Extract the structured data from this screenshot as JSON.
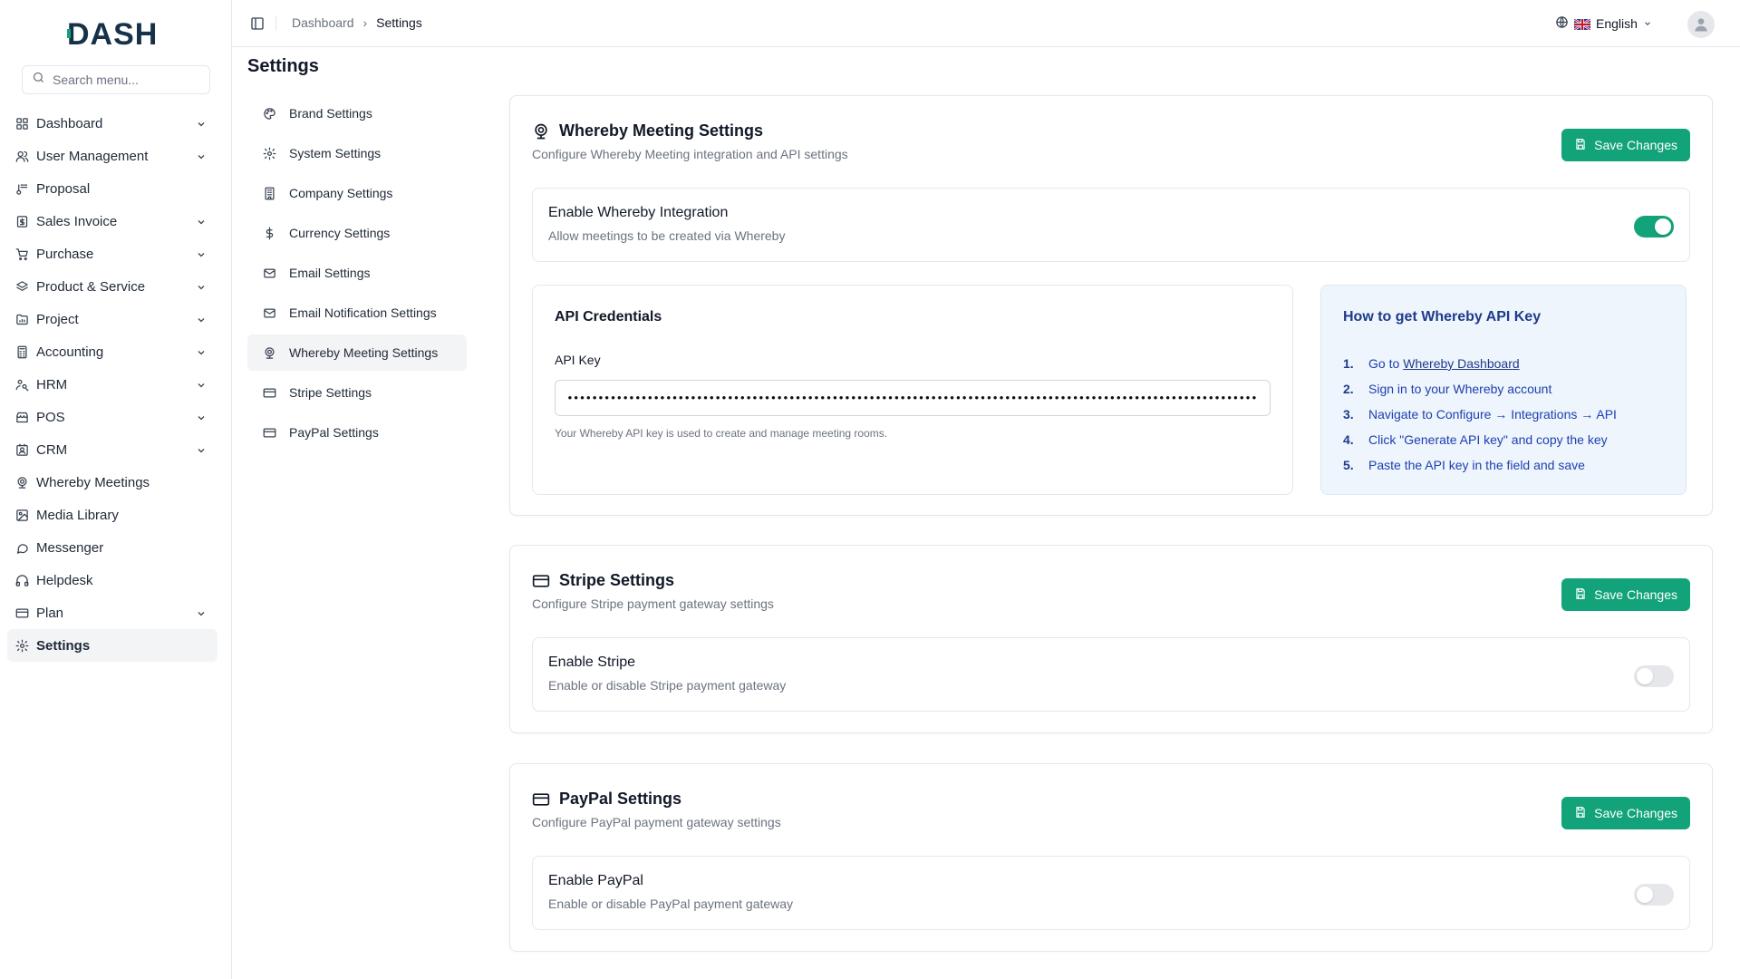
{
  "app": {
    "logo_text": "DASH"
  },
  "search": {
    "placeholder": "Search menu..."
  },
  "sidebar": {
    "items": [
      {
        "label": "Dashboard",
        "icon": "grid-icon",
        "has_children": true
      },
      {
        "label": "User Management",
        "icon": "users-icon",
        "has_children": true
      },
      {
        "label": "Proposal",
        "icon": "proposal-icon",
        "has_children": false
      },
      {
        "label": "Sales Invoice",
        "icon": "invoice-icon",
        "has_children": true
      },
      {
        "label": "Purchase",
        "icon": "cart-icon",
        "has_children": true
      },
      {
        "label": "Product & Service",
        "icon": "layers-icon",
        "has_children": true
      },
      {
        "label": "Project",
        "icon": "folder-icon",
        "has_children": true
      },
      {
        "label": "Accounting",
        "icon": "calculator-icon",
        "has_children": true
      },
      {
        "label": "HRM",
        "icon": "hrm-icon",
        "has_children": true
      },
      {
        "label": "POS",
        "icon": "store-icon",
        "has_children": true
      },
      {
        "label": "CRM",
        "icon": "crm-icon",
        "has_children": true
      },
      {
        "label": "Whereby Meetings",
        "icon": "webcam-icon",
        "has_children": false
      },
      {
        "label": "Media Library",
        "icon": "image-icon",
        "has_children": false
      },
      {
        "label": "Messenger",
        "icon": "message-icon",
        "has_children": false
      },
      {
        "label": "Helpdesk",
        "icon": "headphones-icon",
        "has_children": false
      },
      {
        "label": "Plan",
        "icon": "card-icon",
        "has_children": true
      },
      {
        "label": "Settings",
        "icon": "gear-icon",
        "has_children": false,
        "active": true
      }
    ]
  },
  "header": {
    "breadcrumb": [
      "Dashboard",
      "Settings"
    ],
    "language": "English"
  },
  "page": {
    "title": "Settings"
  },
  "settings_nav": {
    "items": [
      {
        "label": "Brand Settings",
        "icon": "palette-icon"
      },
      {
        "label": "System Settings",
        "icon": "gear-icon"
      },
      {
        "label": "Company Settings",
        "icon": "building-icon"
      },
      {
        "label": "Currency Settings",
        "icon": "dollar-icon"
      },
      {
        "label": "Email Settings",
        "icon": "mail-icon"
      },
      {
        "label": "Email Notification Settings",
        "icon": "mail-icon"
      },
      {
        "label": "Whereby Meeting Settings",
        "icon": "webcam-icon",
        "active": true
      },
      {
        "label": "Stripe Settings",
        "icon": "card-icon"
      },
      {
        "label": "PayPal Settings",
        "icon": "card-icon"
      }
    ]
  },
  "whereby": {
    "title": "Whereby Meeting Settings",
    "subtitle": "Configure Whereby Meeting integration and API settings",
    "save_label": "Save Changes",
    "enable_title": "Enable Whereby Integration",
    "enable_desc": "Allow meetings to be created via Whereby",
    "enabled": true,
    "api": {
      "title": "API Credentials",
      "label": "API Key",
      "value": "••••••••••••••••••••••••••••••••••••••••••••••••••••••••••••••••••••••••••••••••••••••••••••••••••••••••••••••••••••••••••••••••",
      "help": "Your Whereby API key is used to create and manage meeting rooms."
    },
    "howto": {
      "title": "How to get Whereby API Key",
      "steps": [
        {
          "num": "1.",
          "text": "Go to",
          "link": "Whereby Dashboard"
        },
        {
          "num": "2.",
          "text": "Sign in to your Whereby account"
        },
        {
          "num": "3.",
          "text": "Navigate to Configure → Integrations → API"
        },
        {
          "num": "4.",
          "text": "Click \"Generate API key\" and copy the key"
        },
        {
          "num": "5.",
          "text": "Paste the API key in the field and save"
        }
      ]
    }
  },
  "stripe": {
    "title": "Stripe Settings",
    "subtitle": "Configure Stripe payment gateway settings",
    "save_label": "Save Changes",
    "enable_title": "Enable Stripe",
    "enable_desc": "Enable or disable Stripe payment gateway",
    "enabled": false
  },
  "paypal": {
    "title": "PayPal Settings",
    "subtitle": "Configure PayPal payment gateway settings",
    "save_label": "Save Changes",
    "enable_title": "Enable PayPal",
    "enable_desc": "Enable or disable PayPal payment gateway",
    "enabled": false
  },
  "colors": {
    "accent": "#12a37a",
    "help_bg": "#eef5fd",
    "help_text": "#1e3a8a"
  }
}
